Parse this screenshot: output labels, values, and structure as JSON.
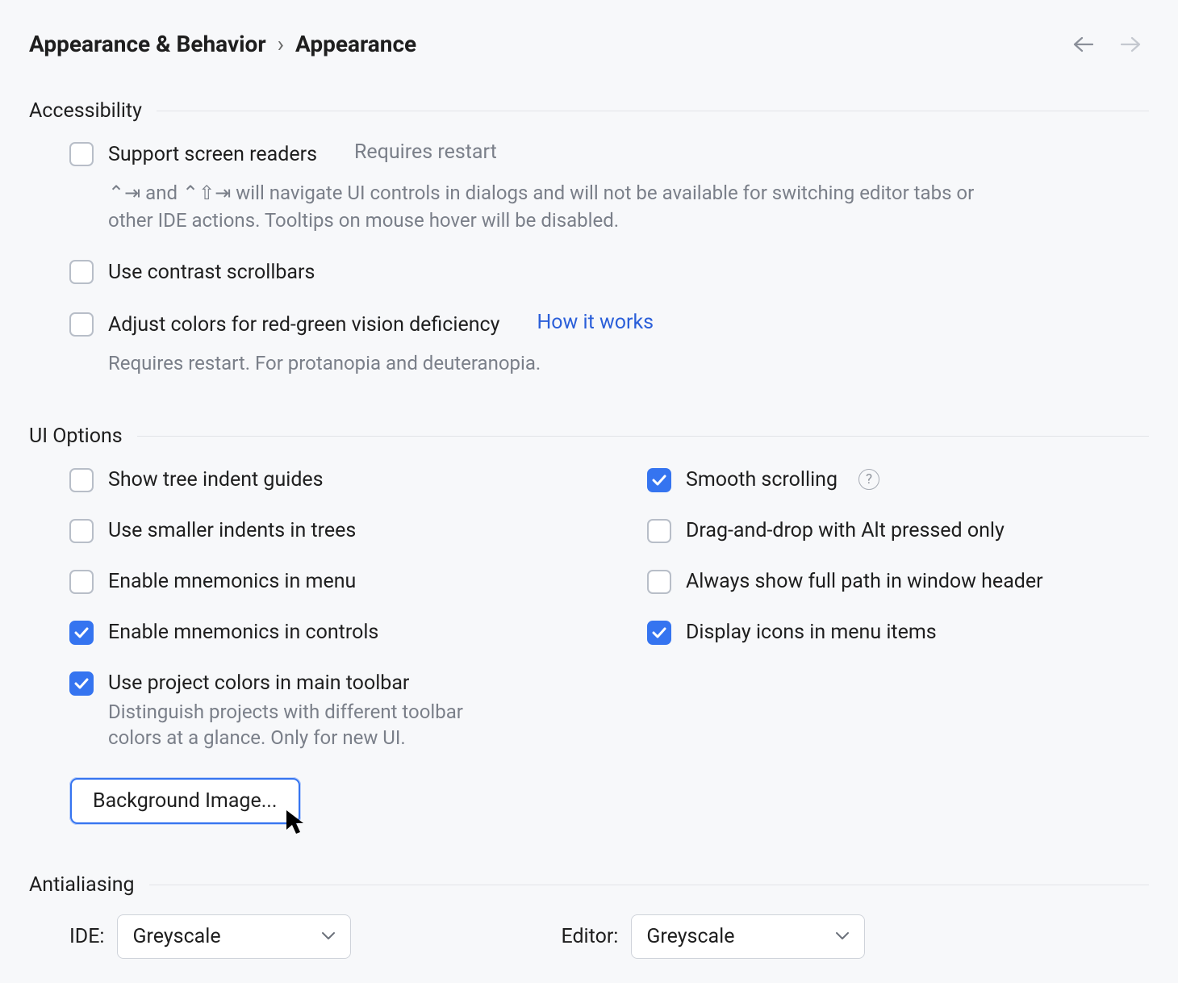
{
  "breadcrumb": {
    "group": "Appearance & Behavior",
    "sep": "›",
    "page": "Appearance"
  },
  "sections": {
    "accessibility": {
      "title": "Accessibility",
      "screen_readers": {
        "label": "Support screen readers",
        "hint": "Requires restart",
        "desc": "⌃⇥ and ⌃⇧⇥ will navigate UI controls in dialogs and will not be available for switching editor tabs or other IDE actions. Tooltips on mouse hover will be disabled.",
        "checked": false
      },
      "contrast_scrollbars": {
        "label": "Use contrast scrollbars",
        "checked": false
      },
      "color_deficiency": {
        "label": "Adjust colors for red-green vision deficiency",
        "link": "How it works",
        "desc": "Requires restart. For protanopia and deuteranopia.",
        "checked": false
      }
    },
    "ui_options": {
      "title": "UI Options",
      "left": {
        "tree_indent_guides": {
          "label": "Show tree indent guides",
          "checked": false
        },
        "smaller_indents": {
          "label": "Use smaller indents in trees",
          "checked": false
        },
        "mnemonics_menu": {
          "label": "Enable mnemonics in menu",
          "checked": false
        },
        "mnemonics_controls": {
          "label": "Enable mnemonics in controls",
          "checked": true
        },
        "project_colors": {
          "label": "Use project colors in main toolbar",
          "desc": "Distinguish projects with different toolbar colors at a glance. Only for new UI.",
          "checked": true
        },
        "background_image_btn": "Background Image..."
      },
      "right": {
        "smooth_scrolling": {
          "label": "Smooth scrolling",
          "checked": true
        },
        "dnd_alt": {
          "label": "Drag-and-drop with Alt pressed only",
          "checked": false
        },
        "full_path_header": {
          "label": "Always show full path in window header",
          "checked": false
        },
        "icons_menu": {
          "label": "Display icons in menu items",
          "checked": true
        }
      }
    },
    "antialiasing": {
      "title": "Antialiasing",
      "ide": {
        "label": "IDE:",
        "value": "Greyscale"
      },
      "editor": {
        "label": "Editor:",
        "value": "Greyscale"
      }
    }
  }
}
